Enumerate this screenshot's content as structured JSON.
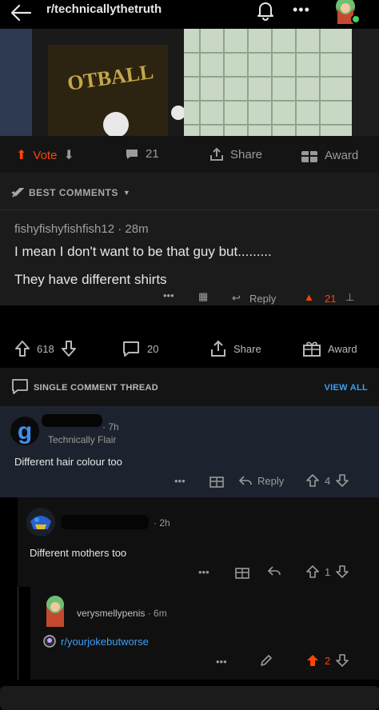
{
  "header": {
    "subreddit": "r/technicallythetruth"
  },
  "post_bar": {
    "vote_label": "Vote",
    "comments": "21",
    "share": "Share",
    "award": "Award"
  },
  "quoted_comment": {
    "sort_label": "BEST COMMENTS",
    "author": "fishyfishyfishfish12",
    "time": "28m",
    "line1": "I mean I don't want to be that guy but.........",
    "line2": "They have different shirts",
    "reply_label": "Reply",
    "score": "21"
  },
  "vote_bar": {
    "upvotes": "618",
    "comments": "20",
    "share": "Share",
    "award": "Award"
  },
  "thread_header": {
    "label": "SINGLE COMMENT THREAD",
    "view_all": "VIEW ALL"
  },
  "comment1": {
    "time": "7h",
    "flair": "Technically Flair",
    "text": "Different hair colour too",
    "reply_label": "Reply",
    "score": "4"
  },
  "comment2": {
    "time": "2h",
    "text": "Different mothers too",
    "score": "1"
  },
  "comment3": {
    "author": "verysmellypenis",
    "time": "6m",
    "link": "r/yourjokebutworse",
    "score": "2"
  },
  "colors": {
    "upvote": "#ff4500",
    "link": "#3d9ff6",
    "highlight_bg": "#1d232e"
  }
}
